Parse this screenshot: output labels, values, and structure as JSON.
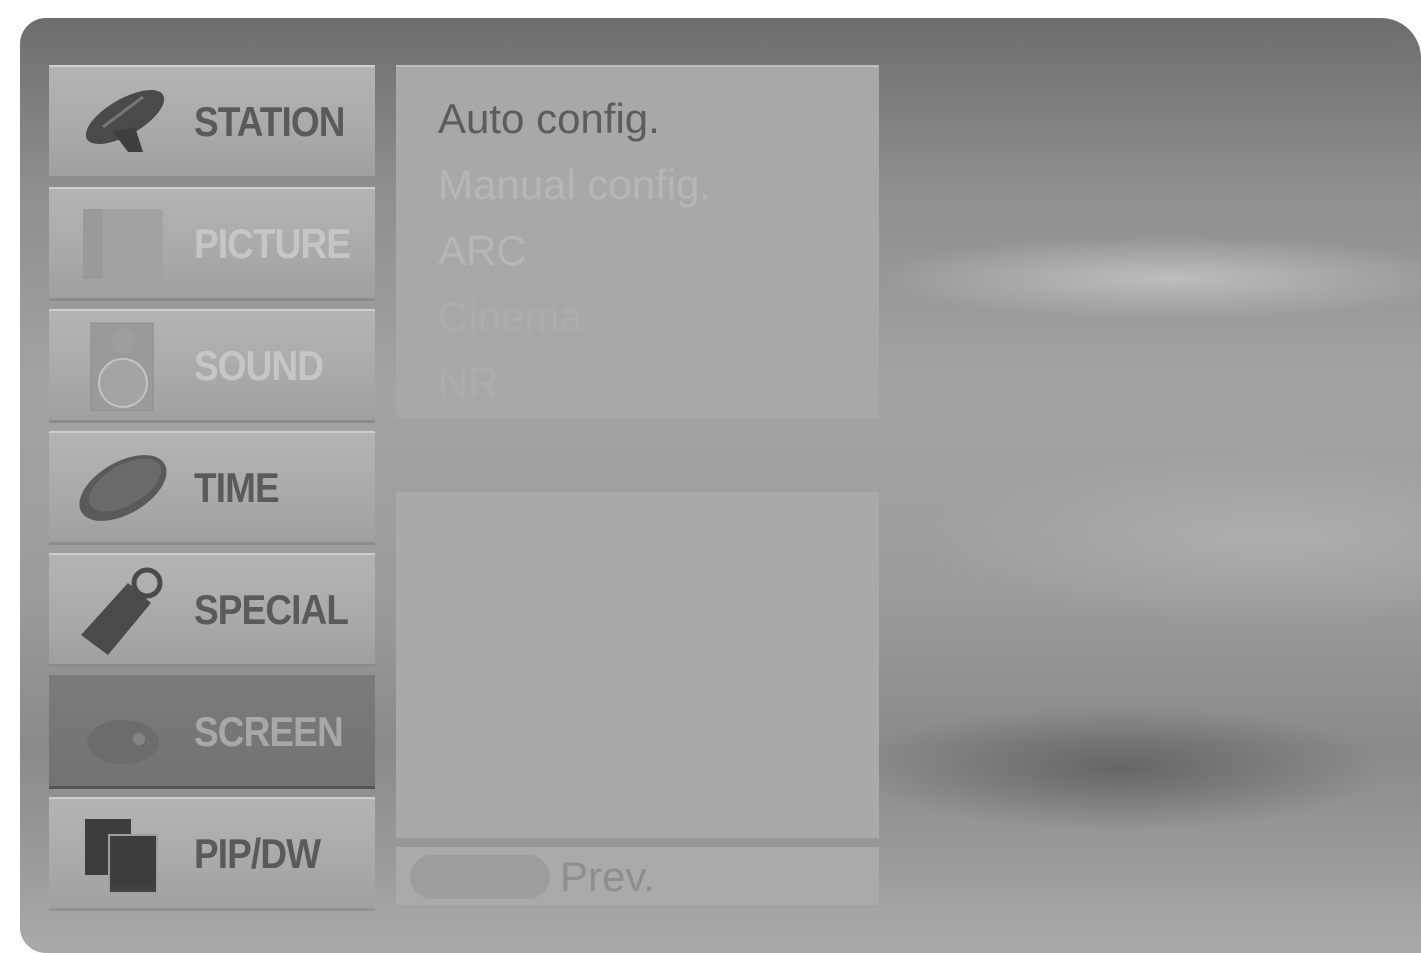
{
  "menu": {
    "items": [
      {
        "label": "STATION",
        "icon": "satellite-dish-icon",
        "state": "enabled"
      },
      {
        "label": "PICTURE",
        "icon": "picture-icon",
        "state": "disabled"
      },
      {
        "label": "SOUND",
        "icon": "speaker-icon",
        "state": "disabled"
      },
      {
        "label": "TIME",
        "icon": "clock-icon",
        "state": "enabled"
      },
      {
        "label": "SPECIAL",
        "icon": "special-tag-icon",
        "state": "enabled"
      },
      {
        "label": "SCREEN",
        "icon": "screen-icon",
        "state": "selected"
      },
      {
        "label": "PIP/DW",
        "icon": "pip-icon",
        "state": "enabled"
      }
    ]
  },
  "submenu": {
    "items": [
      {
        "label": "Auto config.",
        "state": "active"
      },
      {
        "label": "Manual config.",
        "state": "disabled"
      },
      {
        "label": "ARC",
        "state": "disabled"
      },
      {
        "label": "Cinema",
        "state": "disabled"
      },
      {
        "label": "NR",
        "state": "disabled"
      }
    ]
  },
  "footer": {
    "prev_label": "Prev."
  },
  "colors": {
    "menu_item_bg": "#aeaeae",
    "menu_selected_bg": "#767676",
    "active_text": "#5c5c5c",
    "disabled_text": "#c4c4c4"
  }
}
